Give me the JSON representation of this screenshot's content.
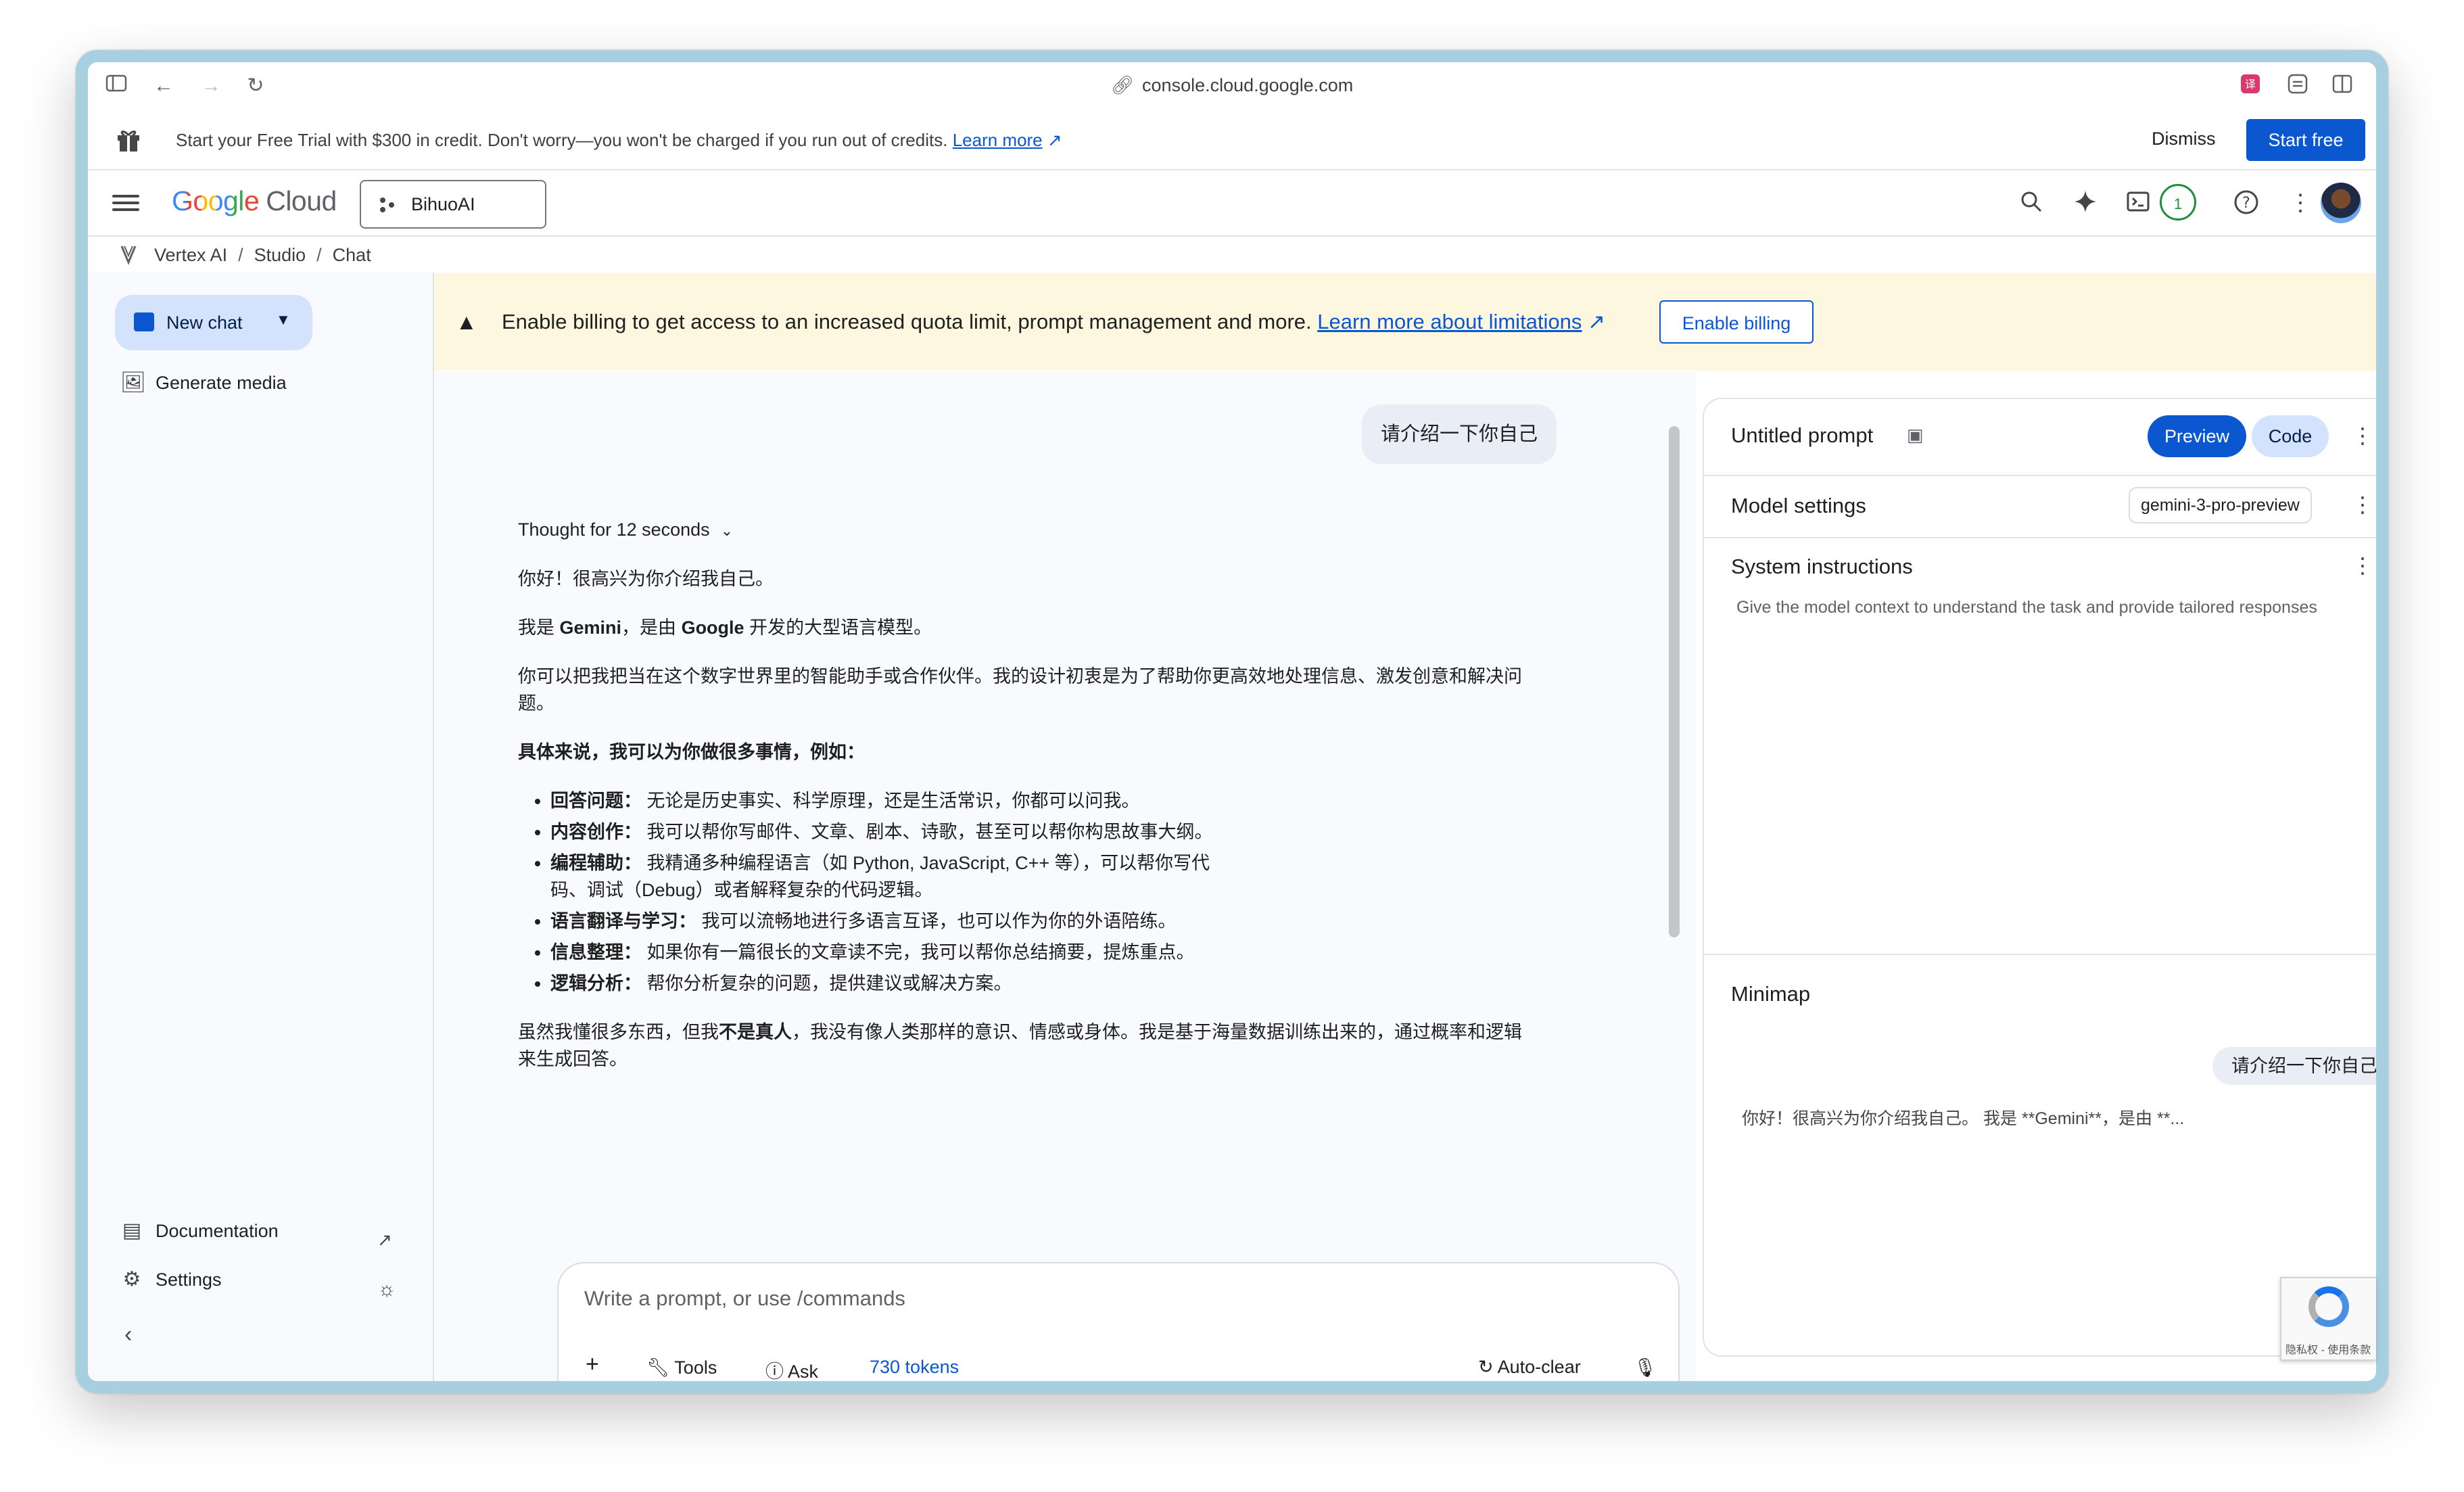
{
  "browser": {
    "url": "console.cloud.google.com"
  },
  "trial_banner": {
    "message": "Start your Free Trial with $300 in credit. Don't worry—you won't be charged if you run out of credits.",
    "learn_more": "Learn more",
    "dismiss": "Dismiss",
    "start_free": "Start free"
  },
  "topnav": {
    "logo_google": "Google",
    "logo_cloud": "Cloud",
    "project": "BihuoAI",
    "notification_count": "1"
  },
  "breadcrumb": {
    "items": [
      "Vertex AI",
      "Studio",
      "Chat"
    ]
  },
  "sidebar": {
    "new_chat": "New chat",
    "generate_media": "Generate media",
    "documentation": "Documentation",
    "settings": "Settings"
  },
  "billing_banner": {
    "text": "Enable billing to get access to an increased quota limit, prompt management and more.",
    "link": "Learn more about limitations",
    "button": "Enable billing"
  },
  "chat": {
    "user_message": "请介绍一下你自己",
    "thought": "Thought for 12 seconds",
    "p1": "你好！很高兴为你介绍我自己。",
    "p2_pre": "我是 ",
    "p2_bold1": "Gemini",
    "p2_mid": "，是由 ",
    "p2_bold2": "Google",
    "p2_post": " 开发的大型语言模型。",
    "p3": "你可以把我把当在这个数字世界里的智能助手或合作伙伴。我的设计初衷是为了帮助你更高效地处理信息、激发创意和解决问题。",
    "p4_bold": "具体来说，我可以为你做很多事情，例如：",
    "list": [
      {
        "label": "回答问题：",
        "text": " 无论是历史事实、科学原理，还是生活常识，你都可以问我。"
      },
      {
        "label": "内容创作：",
        "text": " 我可以帮你写邮件、文章、剧本、诗歌，甚至可以帮你构思故事大纲。"
      },
      {
        "label": "编程辅助：",
        "text": " 我精通多种编程语言（如 Python, JavaScript, C++ 等），可以帮你写代码、调试（Debug）或者解释复杂的代码逻辑。"
      },
      {
        "label": "语言翻译与学习：",
        "text": " 我可以流畅地进行多语言互译，也可以作为你的外语陪练。"
      },
      {
        "label": "信息整理：",
        "text": " 如果你有一篇很长的文章读不完，我可以帮你总结摘要，提炼重点。"
      },
      {
        "label": "逻辑分析：",
        "text": " 帮你分析复杂的问题，提供建议或解决方案。"
      }
    ],
    "p5_pre": "虽然我懂很多东西，但我",
    "p5_bold": "不是真人",
    "p5_post": "，我没有像人类那样的意识、情感或身体。我是基于海量数据训练出来的，通过概率和逻辑来生成回答。"
  },
  "composer": {
    "placeholder": "Write a prompt, or use /commands",
    "tools": "Tools",
    "ask": "Ask",
    "tokens": "730 tokens",
    "auto_clear": "Auto-clear"
  },
  "panel": {
    "title": "Untitled prompt",
    "preview": "Preview",
    "code": "Code",
    "model_settings": "Model settings",
    "model": "gemini-3-pro-preview",
    "system_instructions": "System instructions",
    "system_placeholder": "Give the model context to understand the task and provide tailored responses",
    "minimap": "Minimap",
    "minimap_user": "请介绍一下你自己",
    "minimap_model": "你好！很高兴为你介绍我自己。 我是 **Gemini**，是由 **..."
  },
  "recaptcha": {
    "text": "隐私权 - 使用条款"
  },
  "colors": {
    "accent": "#0b57d0",
    "banner_bg": "#fef7e0",
    "chip_bg": "#d3e3fd"
  }
}
